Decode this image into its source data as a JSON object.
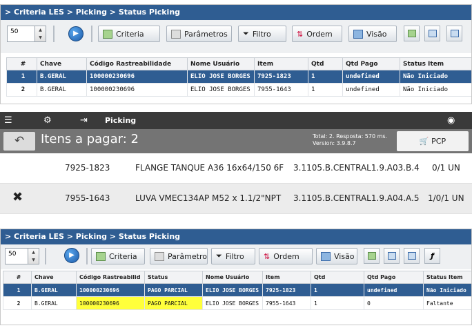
{
  "panel1": {
    "breadcrumb": "> Criteria LES > Picking > Status Picking",
    "rows_value": "50",
    "toolbar": {
      "criteria": "Criteria",
      "parametros": "Parâmetros",
      "filtro": "Filtro",
      "ordem": "Ordem",
      "visao": "Visão"
    },
    "columns": [
      "#",
      "Chave",
      "Código Rastreabilidade",
      "Nome Usuário",
      "Item",
      "Qtd",
      "Qtd Pago",
      "Status Item"
    ],
    "rows": [
      {
        "n": "1",
        "chave": "B.GERAL",
        "codigo": "100000230696",
        "nome": "ELIO JOSE BORGES [",
        "item": "7925-1823",
        "qtd": "1",
        "qtd_pago": "undefined",
        "status": "Não Iniciado"
      },
      {
        "n": "2",
        "chave": "B.GERAL",
        "codigo": "100000230696",
        "nome": "ELIO JOSE BORGES [",
        "item": "7955-1643",
        "qtd": "1",
        "qtd_pago": "undefined",
        "status": "Não Iniciado"
      }
    ]
  },
  "mobile": {
    "topbar_title": "Picking",
    "header_title": "Itens a pagar: 2",
    "info_line1": "Total: 2. Resposta: 570 ms.",
    "info_line2": "Version: 3.9.8.7",
    "pcp_label": "PCP",
    "rows": [
      {
        "code": "7925-1823",
        "desc": "FLANGE TANQUE A36 16x64/150 6F",
        "loc": "3.1105.B.CENTRAL1.9.A03.B.4",
        "qty": "0/1 UN"
      },
      {
        "code": "7955-1643",
        "desc": "LUVA VMEC134AP M52 x 1.1/2\"NPT",
        "loc": "3.1105.B.CENTRAL1.9.A04.A.5",
        "qty": "1/0/1 UN"
      }
    ]
  },
  "panel2": {
    "breadcrumb": "> Criteria LES > Picking > Status Picking",
    "rows_value": "50",
    "toolbar": {
      "criteria": "Criteria",
      "parametros": "Parâmetros",
      "filtro": "Filtro",
      "ordem": "Ordem",
      "visao": "Visão"
    },
    "columns": [
      "#",
      "Chave",
      "Código Rastreabilid",
      "Status",
      "Nome Usuário",
      "Item",
      "Qtd",
      "Qtd Pago",
      "Status Item"
    ],
    "rows": [
      {
        "n": "1",
        "chave": "B.GERAL",
        "codigo": "100000230696",
        "status": "PAGO PARCIAL",
        "nome": "ELIO JOSE BORGES",
        "item": "7925-1823",
        "qtd": "1",
        "qtd_pago": "undefined",
        "status_item": "Não Iniciado"
      },
      {
        "n": "2",
        "chave": "B.GERAL",
        "codigo": "100000230696",
        "status": "PAGO PARCIAL",
        "nome": "ELIO JOSE BORGES",
        "item": "7955-1643",
        "qtd": "1",
        "qtd_pago": "0",
        "status_item": "Faltante"
      }
    ]
  },
  "colors": {
    "breadcrumb_bar": "#2f5d92",
    "selected_row": "#2f5d92",
    "highlight": "#ffff3b",
    "mobile_bar": "#3a3a3a",
    "mobile_header": "#747474"
  }
}
